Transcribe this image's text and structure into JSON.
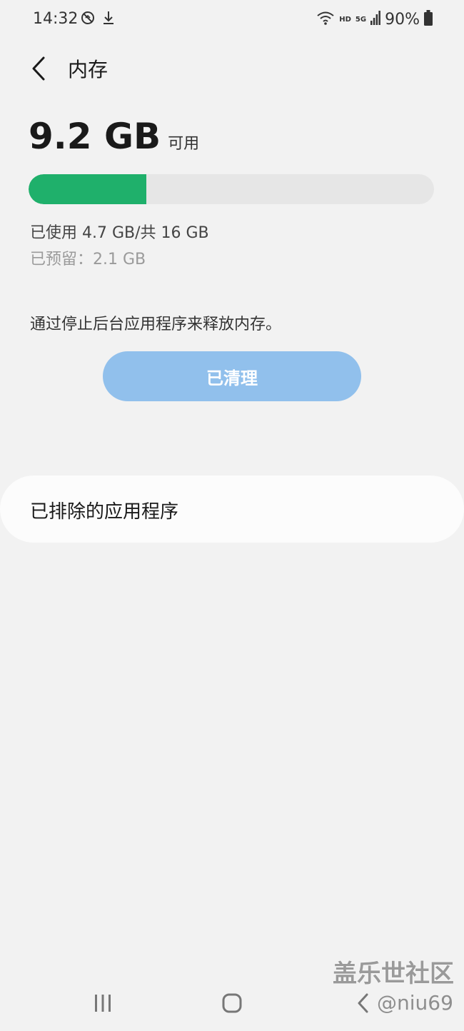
{
  "status_bar": {
    "time": "14:32",
    "network_hd": "HD",
    "network_5g": "5G",
    "battery_percent": "90%",
    "icons": [
      "sync-off-icon",
      "download-icon",
      "wifi-icon",
      "signal-icon",
      "battery-icon"
    ]
  },
  "header": {
    "title": "内存",
    "back_icon": "chevron-left-icon"
  },
  "memory": {
    "available_value": "9.2 GB",
    "available_label": "可用",
    "used_fraction": 0.29,
    "used_text": "已使用 4.7 GB/共 16 GB",
    "reserved_text": "已预留：2.1 GB",
    "fill_color": "#1fb06b"
  },
  "cleanup": {
    "description": "通过停止后台应用程序来释放内存。",
    "button_label": "已清理",
    "button_color": "#91c0ec"
  },
  "excluded": {
    "label": "已排除的应用程序"
  },
  "watermark": {
    "title": "盖乐世社区",
    "user": "@niu69"
  },
  "nav": {
    "icons": [
      "recent-apps-icon",
      "home-icon",
      "back-icon"
    ]
  }
}
